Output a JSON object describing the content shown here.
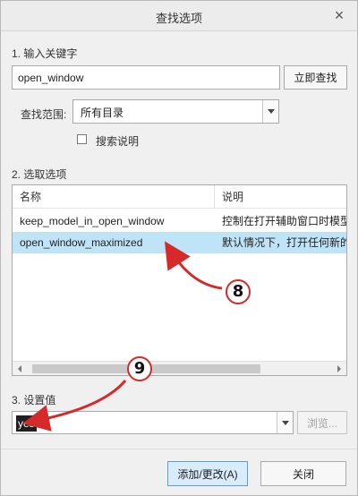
{
  "dialog": {
    "title": "查找选项",
    "close_glyph": "×"
  },
  "step1": {
    "label": "1.  输入关键字",
    "keyword_value": "open_window",
    "search_button": "立即查找",
    "scope_label": "查找范围:",
    "scope_value": "所有目录",
    "search_desc_label": "搜索说明",
    "search_desc_checked": false
  },
  "step2": {
    "label": "2.  选取选项",
    "columns": [
      "名称",
      "说明"
    ],
    "rows": [
      {
        "name": "keep_model_in_open_window",
        "desc": "控制在打开辅助窗口时模型",
        "selected": false
      },
      {
        "name": "open_window_maximized",
        "desc": "默认情况下，打开任何新的",
        "selected": true
      }
    ]
  },
  "step3": {
    "label": "3.  设置值",
    "value": "yes",
    "browse_button": "浏览..."
  },
  "footer": {
    "add_button": "添加/更改(A)",
    "close_button": "关闭"
  },
  "annotations": {
    "badge_8": "8",
    "badge_9": "9",
    "color": "#d62a2a"
  },
  "icons": {
    "close": "close-icon",
    "dropdown": "chevron-down-icon",
    "scroll_left": "scroll-left-icon",
    "scroll_right": "scroll-right-icon"
  }
}
